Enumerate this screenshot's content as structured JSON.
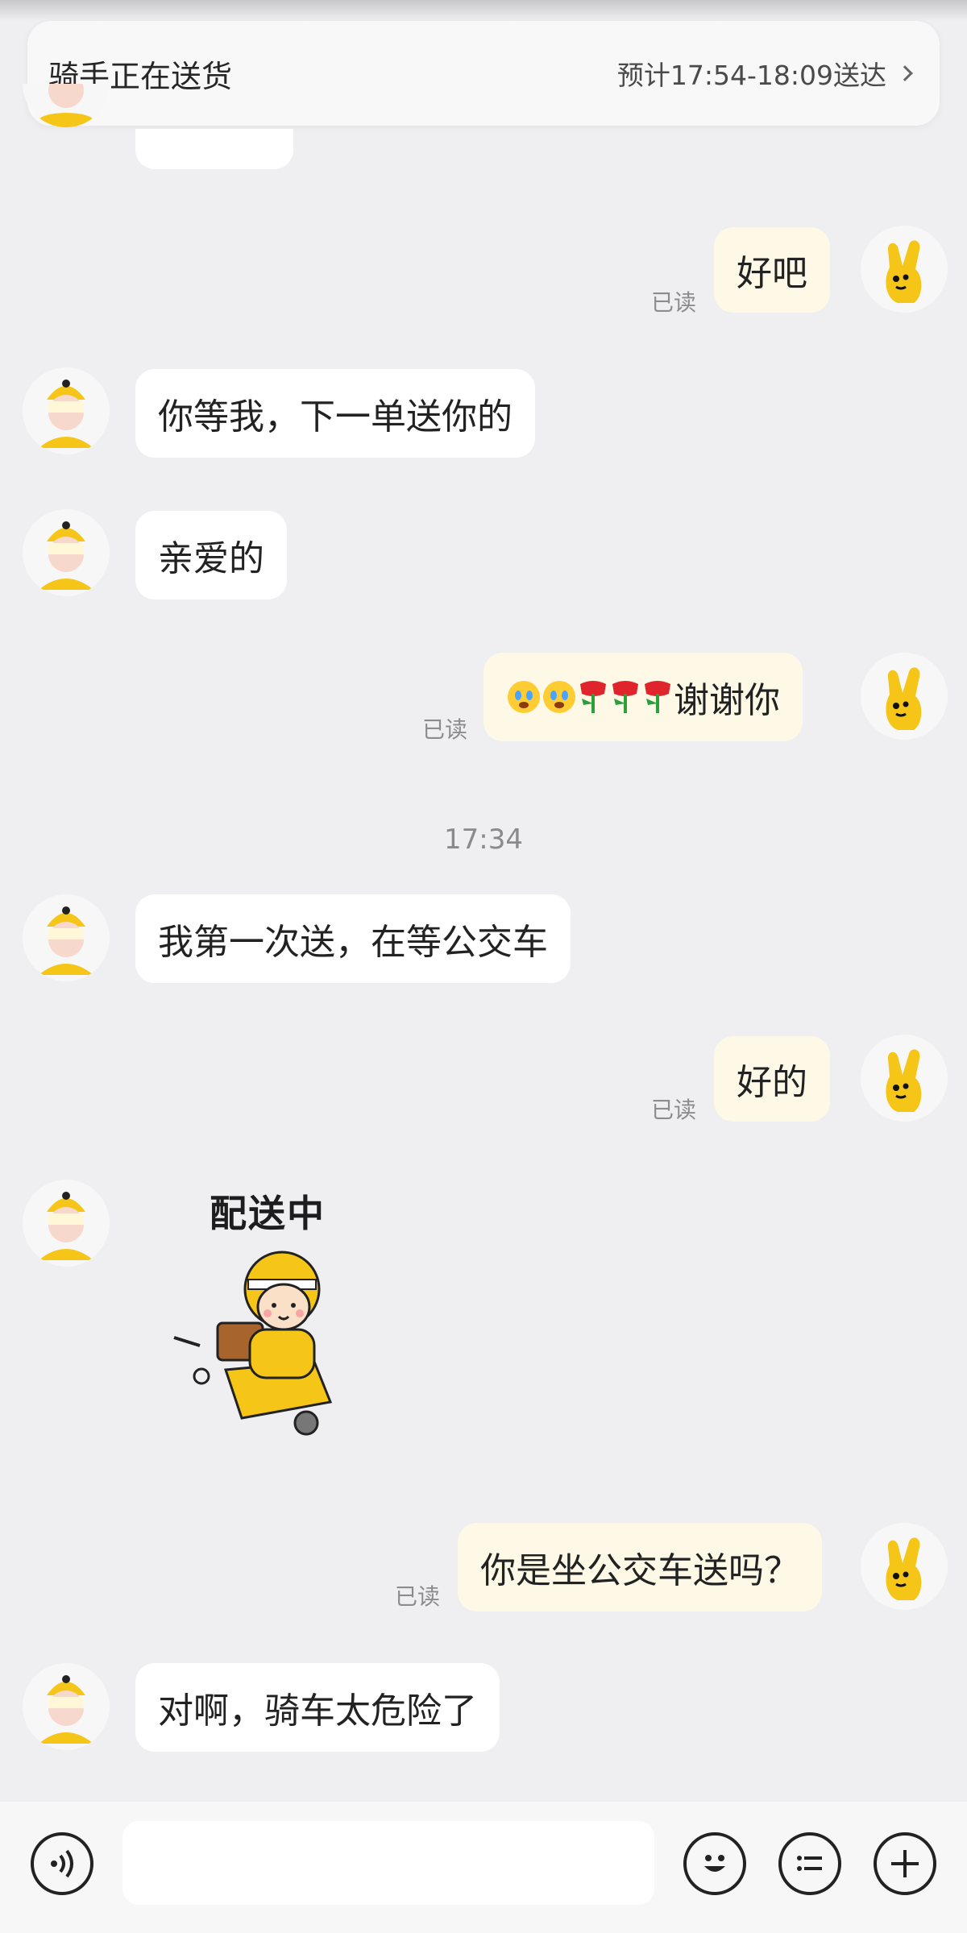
{
  "banner": {
    "title": "骑手正在送货",
    "eta": "预计17:54-18:09送达"
  },
  "messages": [
    {
      "side": "right",
      "text": "好吧",
      "read": "已读"
    },
    {
      "side": "left",
      "text": "你等我，下一单送你的"
    },
    {
      "side": "left",
      "text": "亲爱的"
    },
    {
      "side": "right",
      "text": "谢谢你",
      "emoji": [
        "crying-face",
        "crying-face",
        "wilted-rose",
        "wilted-rose",
        "wilted-rose"
      ],
      "read": "已读"
    },
    {
      "side": "left",
      "text": "我第一次送，在等公交车"
    },
    {
      "side": "right",
      "text": "好的",
      "read": "已读"
    },
    {
      "side": "left",
      "sticker": "配送中"
    },
    {
      "side": "right",
      "text": "你是坐公交车送吗？",
      "read": "已读"
    },
    {
      "side": "left",
      "text": "对啊，骑车太危险了"
    }
  ],
  "time_separator": "17:34",
  "icons": {
    "voice": "voice-icon",
    "emoji": "emoji-icon",
    "quick_reply": "quick-reply-icon",
    "more": "plus-icon",
    "chevron": "chevron-right-icon"
  },
  "colors": {
    "background": "#efeff1",
    "my_bubble": "#fdf9e6",
    "their_bubble": "#ffffff",
    "rider_yellow": "#f5c518"
  }
}
